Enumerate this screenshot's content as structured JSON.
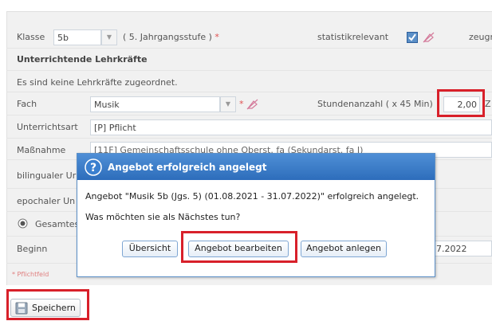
{
  "form": {
    "klasse_label": "Klasse",
    "klasse_value": "5b",
    "jahrgang_text": "( 5. Jahrgangsstufe )",
    "required_mark": "*",
    "statistik_label": "statistikrelevant",
    "zeugnis_label": "zeugr",
    "lehrkraefte_heading": "Unterrichtende Lehrkräfte",
    "keine_lehrkraefte": "Es sind keine Lehrkräfte zugeordnet.",
    "fach_label": "Fach",
    "fach_value": "Musik",
    "stunden_label": "Stundenanzahl ( x 45 Min)",
    "stunden_value": "2,00",
    "stunden_suffix": "Z",
    "unterrichtsart_label": "Unterrichtsart",
    "unterrichtsart_value": "[P] Pflicht",
    "massnahme_label": "Maßnahme",
    "massnahme_value": "[11F] Gemeinschaftsschule ohne Oberst. fa (Sekundarst. fa I)",
    "bilingual_label": "bilingualer Ur",
    "epochal_label": "epochaler Un",
    "gesamt_label": "Gesamtes",
    "beginn_label": "Beginn",
    "beginn_value_partial": "7.2022",
    "pflichtfeld_note": "* Pflichtfeld"
  },
  "dialog": {
    "icon": "question-icon",
    "title": "Angebot erfolgreich angelegt",
    "message": "Angebot \"Musik 5b (Jgs. 5) (01.08.2021 - 31.07.2022)\" erfolgreich angelegt.",
    "question": "Was möchten sie als Nächstes tun?",
    "buttons": {
      "overview": "Übersicht",
      "edit": "Angebot bearbeiten",
      "create": "Angebot anlegen"
    }
  },
  "footer": {
    "save_icon": "floppy-disk-icon",
    "save_label": "Speichern"
  },
  "colors": {
    "highlight_red": "#d8202a",
    "dialog_blue": "#2d6dbb",
    "required_red": "#e05050"
  }
}
